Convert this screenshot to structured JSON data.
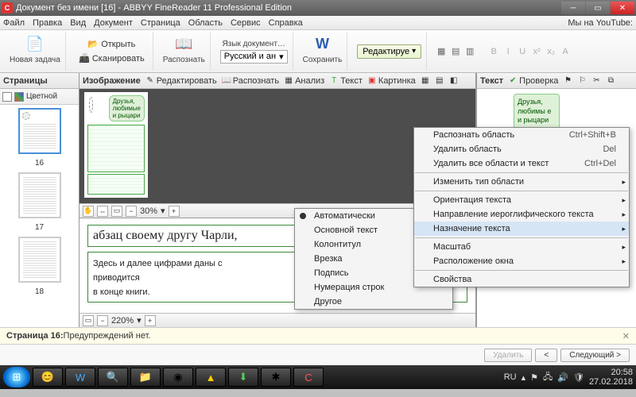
{
  "window": {
    "title": "Документ без имени [16] - ABBYY FineReader 11 Professional Edition"
  },
  "menu": {
    "file": "Файл",
    "edit": "Правка",
    "view": "Вид",
    "document": "Документ",
    "page": "Страница",
    "area": "Область",
    "tools": "Сервис",
    "help": "Справка",
    "youtube": "Мы на YouTube:"
  },
  "ribbon": {
    "new_task": "Новая задача",
    "open": "Открыть",
    "scan": "Сканировать",
    "recognize": "Распознать",
    "doc_lang": "Язык документ…",
    "lang_value": "Русский и ан",
    "save": "Сохранить",
    "edit_btn": "Редактируе"
  },
  "panes": {
    "pages": "Страницы",
    "image": "Изображение",
    "text": "Текст",
    "color_chip": "Цветной",
    "img_tb": {
      "edit": "Редактировать",
      "recognize": "Распознать",
      "analyze": "Анализ",
      "txt": "Текст",
      "pic": "Картинка"
    },
    "txt_tb": {
      "check": "Проверка"
    }
  },
  "thumbs": {
    "p16": "16",
    "p17": "17",
    "p18": "18"
  },
  "bubble": "Друзья, любимые и рыцари",
  "bubble2": "Друзья, любимы е и рыцари",
  "zoom": {
    "top": "30%",
    "bottom": "220%"
  },
  "serif": {
    "line1": "абзац своему другу Чарли,",
    "line2": "Здесь и далее цифрами даны с",
    "line2b": "и, список которых приводится",
    "line3": "в конце книги."
  },
  "ctx1": {
    "auto": "Автоматически",
    "main": "Основной текст",
    "header": "Колонтитул",
    "inset": "Врезка",
    "caption": "Подпись",
    "lines": "Нумерация строк",
    "other": "Другое"
  },
  "ctx2": {
    "recog_area": "Распознать область",
    "recog_sc": "Ctrl+Shift+B",
    "del_area": "Удалить область",
    "del_sc": "Del",
    "del_all": "Удалить все области и текст",
    "delall_sc": "Ctrl+Del",
    "change_type": "Изменить тип области",
    "orient": "Ориентация текста",
    "hiero": "Направление иероглифического текста",
    "assign": "Назначение текста",
    "scale": "Масштаб",
    "layout": "Расположение окна",
    "props": "Свойства"
  },
  "status": {
    "prefix": "Страница 16:",
    "msg": " Предупреждений нет."
  },
  "nav": {
    "del": "Удалить",
    "prev": "<",
    "next": "Следующий  >"
  },
  "tray": {
    "lang": "RU",
    "time": "20:58",
    "date": "27.02.2018"
  }
}
